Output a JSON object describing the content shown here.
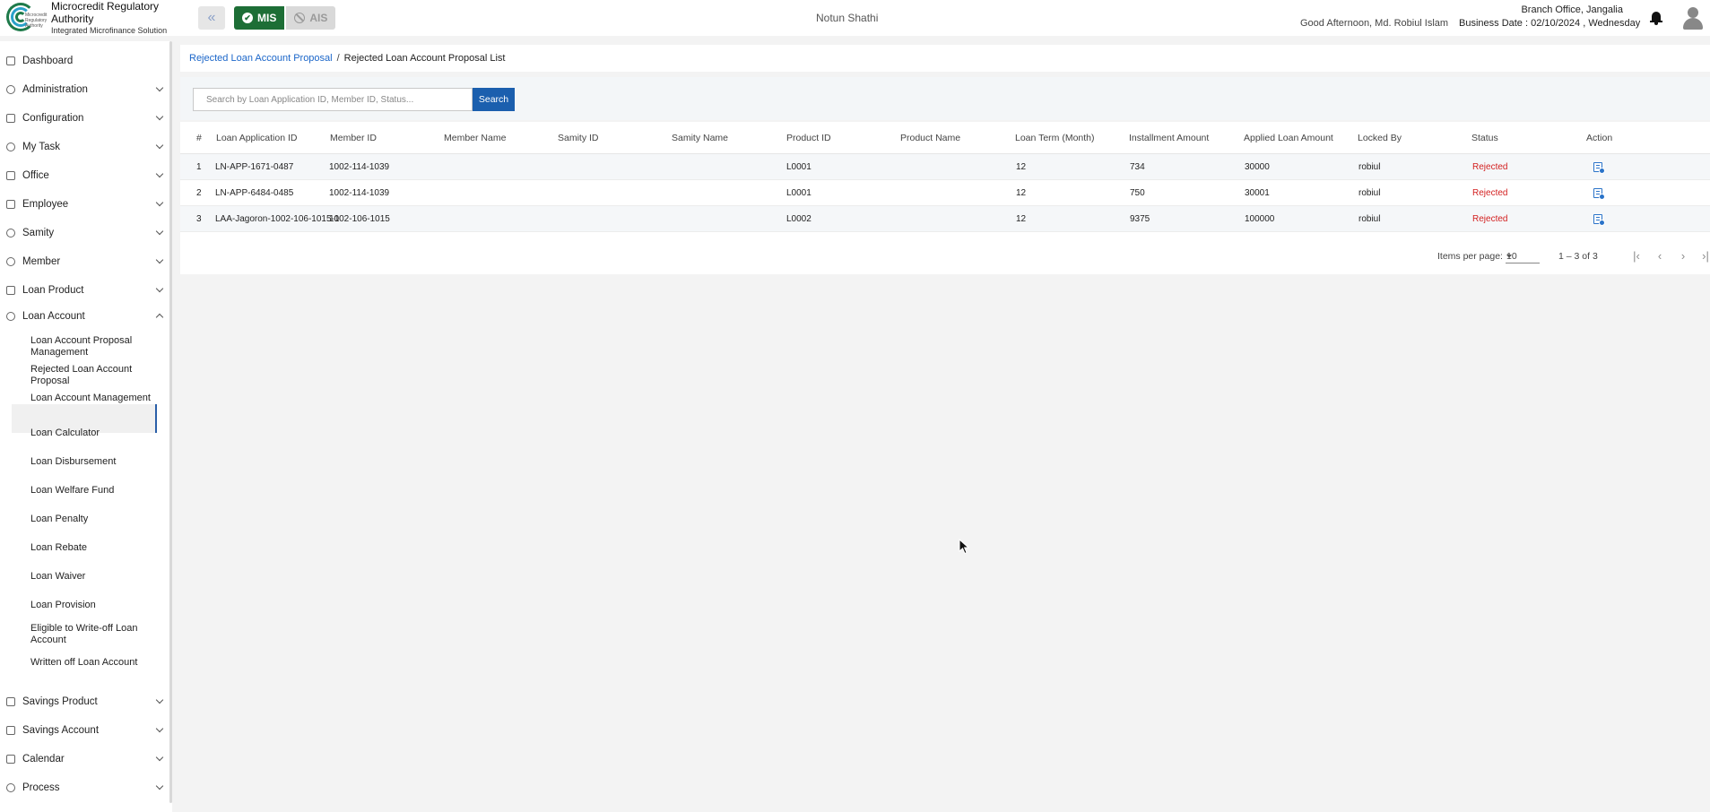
{
  "header": {
    "brand_title": "Microcredit Regulatory Authority",
    "brand_subtitle": "Integrated Microfinance Solution",
    "logo_text": "Microcredit Regulatory Authority",
    "mode_mis": "MIS",
    "mode_ais": "AIS",
    "org_name": "Notun Shathi",
    "greeting": "Good Afternoon, Md. Robiul Islam",
    "branch": "Branch Office, Jangalia",
    "business_date": "Business Date : 02/10/2024 , Wednesday",
    "icons": [
      "double-chevron-left-icon",
      "check-circle-icon",
      "ban-icon",
      "bell-icon",
      "user-avatar-icon"
    ]
  },
  "sidebar": {
    "items": [
      {
        "label": "Dashboard",
        "icon": "grid-icon"
      },
      {
        "label": "Administration",
        "icon": "admin-icon"
      },
      {
        "label": "Configuration",
        "icon": "sliders-icon"
      },
      {
        "label": "My Task",
        "icon": "task-icon"
      },
      {
        "label": "Office",
        "icon": "office-icon"
      },
      {
        "label": "Employee",
        "icon": "employee-icon"
      },
      {
        "label": "Samity",
        "icon": "samity-icon"
      },
      {
        "label": "Member",
        "icon": "member-icon"
      },
      {
        "label": "Loan Product",
        "icon": "loan-product-icon"
      },
      {
        "label": "Loan Account",
        "icon": "loan-account-icon"
      }
    ],
    "loan_account_sub": [
      "Loan Account Proposal Management",
      "Rejected Loan Account Proposal",
      "Loan Account Management",
      "Loan Calculator",
      "Loan Disbursement",
      "Loan Welfare Fund",
      "Loan Penalty",
      "Loan Rebate",
      "Loan Waiver",
      "Loan Provision",
      "Eligible to Write-off Loan Account",
      "Written off Loan Account"
    ],
    "bottom_items": [
      {
        "label": "Savings Product",
        "icon": "savings-product-icon"
      },
      {
        "label": "Savings Account",
        "icon": "savings-account-icon"
      },
      {
        "label": "Calendar",
        "icon": "calendar-icon"
      },
      {
        "label": "Process",
        "icon": "process-icon"
      }
    ]
  },
  "breadcrumb": {
    "link": "Rejected Loan Account Proposal",
    "separator": "/",
    "current": "Rejected Loan Account Proposal List"
  },
  "search": {
    "placeholder": "Search by Loan Application ID, Member ID, Status...",
    "value": "",
    "button": "Search"
  },
  "table": {
    "columns": [
      "#",
      "Loan Application ID",
      "Member ID",
      "Member Name",
      "Samity ID",
      "Samity Name",
      "Product ID",
      "Product Name",
      "Loan Term (Month)",
      "Installment Amount",
      "Applied Loan Amount",
      "Locked By",
      "Status",
      "Action"
    ],
    "rows": [
      [
        "1",
        "LN-APP-1671-0487",
        "1002-114-1039",
        "",
        "",
        "",
        "L0001",
        "",
        "12",
        "734",
        "30000",
        "robiul",
        "Rejected"
      ],
      [
        "2",
        "LN-APP-6484-0485",
        "1002-114-1039",
        "",
        "",
        "",
        "L0001",
        "",
        "12",
        "750",
        "30001",
        "robiul",
        "Rejected"
      ],
      [
        "3",
        "LAA-Jagoron-1002-106-1015-1",
        "1002-106-1015",
        "",
        "",
        "",
        "L0002",
        "",
        "12",
        "9375",
        "100000",
        "robiul",
        "Rejected"
      ]
    ]
  },
  "paginator": {
    "items_per_page_label": "Items per page:",
    "items_per_page": "10",
    "range": "1 – 3 of 3"
  },
  "colors": {
    "brand_green": "#1d6e36",
    "primary_blue": "#1b5fae",
    "link_blue": "#1b66c9",
    "rejected_red": "#d32020"
  }
}
